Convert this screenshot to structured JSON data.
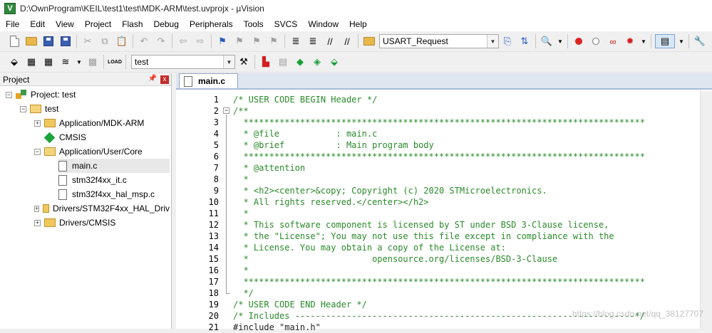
{
  "window": {
    "title": "D:\\OwnProgram\\KEIL\\test1\\test\\MDK-ARM\\test.uvprojx - µVision"
  },
  "menu": [
    "File",
    "Edit",
    "View",
    "Project",
    "Flash",
    "Debug",
    "Peripherals",
    "Tools",
    "SVCS",
    "Window",
    "Help"
  ],
  "toolbar": {
    "find_combo_value": "USART_Request",
    "target_combo_value": "test"
  },
  "project_panel": {
    "title": "Project",
    "pin_glyph": "ᵖ",
    "close_glyph": "x",
    "tree": [
      {
        "label": "Project: test",
        "level": 0,
        "expander": "−",
        "icon": "project"
      },
      {
        "label": "test",
        "level": 1,
        "expander": "−",
        "icon": "folder-open"
      },
      {
        "label": "Application/MDK-ARM",
        "level": 2,
        "expander": "+",
        "icon": "folder"
      },
      {
        "label": "CMSIS",
        "level": 2,
        "expander": "",
        "icon": "diamond"
      },
      {
        "label": "Application/User/Core",
        "level": 2,
        "expander": "−",
        "icon": "folder-open"
      },
      {
        "label": "main.c",
        "level": 3,
        "expander": "",
        "icon": "file",
        "selected": true
      },
      {
        "label": "stm32f4xx_it.c",
        "level": 3,
        "expander": "",
        "icon": "file"
      },
      {
        "label": "stm32f4xx_hal_msp.c",
        "level": 3,
        "expander": "",
        "icon": "file"
      },
      {
        "label": "Drivers/STM32F4xx_HAL_Driv",
        "level": 2,
        "expander": "+",
        "icon": "folder"
      },
      {
        "label": "Drivers/CMSIS",
        "level": 2,
        "expander": "+",
        "icon": "folder"
      }
    ]
  },
  "editor": {
    "tab_label": "main.c",
    "lines": [
      {
        "n": "1",
        "text": "/* USER CODE BEGIN Header */",
        "kind": "comment"
      },
      {
        "n": "2",
        "text": "/**",
        "kind": "comment"
      },
      {
        "n": "3",
        "text": "  ******************************************************************************",
        "kind": "comment"
      },
      {
        "n": "4",
        "text": "  * @file           : main.c",
        "kind": "comment"
      },
      {
        "n": "5",
        "text": "  * @brief          : Main program body",
        "kind": "comment"
      },
      {
        "n": "6",
        "text": "  ******************************************************************************",
        "kind": "comment"
      },
      {
        "n": "7",
        "text": "  * @attention",
        "kind": "comment"
      },
      {
        "n": "8",
        "text": "  *",
        "kind": "comment"
      },
      {
        "n": "9",
        "text": "  * <h2><center>&copy; Copyright (c) 2020 STMicroelectronics.",
        "kind": "comment"
      },
      {
        "n": "10",
        "text": "  * All rights reserved.</center></h2>",
        "kind": "comment"
      },
      {
        "n": "11",
        "text": "  *",
        "kind": "comment"
      },
      {
        "n": "12",
        "text": "  * This software component is licensed by ST under BSD 3-Clause license,",
        "kind": "comment"
      },
      {
        "n": "13",
        "text": "  * the \"License\"; You may not use this file except in compliance with the",
        "kind": "comment"
      },
      {
        "n": "14",
        "text": "  * License. You may obtain a copy of the License at:",
        "kind": "comment"
      },
      {
        "n": "15",
        "text": "  *                        opensource.org/licenses/BSD-3-Clause",
        "kind": "comment"
      },
      {
        "n": "16",
        "text": "  *",
        "kind": "comment"
      },
      {
        "n": "17",
        "text": "  ******************************************************************************",
        "kind": "comment"
      },
      {
        "n": "18",
        "text": "  */",
        "kind": "comment"
      },
      {
        "n": "19",
        "text": "/* USER CODE END Header */",
        "kind": "comment"
      },
      {
        "n": "20",
        "text": "/* Includes ------------------------------------------------------------------*/",
        "kind": "comment"
      },
      {
        "n": "21",
        "text": "#include \"main.h\"",
        "kind": "pp"
      }
    ]
  },
  "watermark": "https://blog.csdn.net/qq_38127707"
}
